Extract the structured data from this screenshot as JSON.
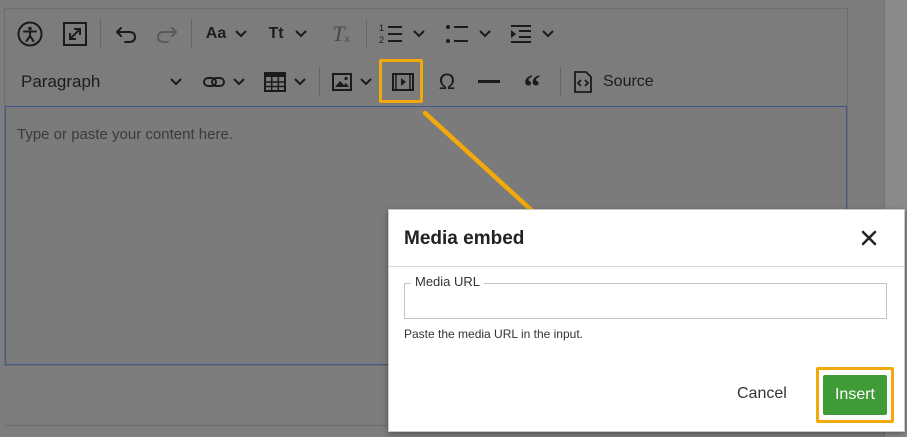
{
  "toolbar": {
    "paragraph_label": "Paragraph",
    "source_label": "Source"
  },
  "editor": {
    "placeholder": "Type or paste your content here."
  },
  "dialog": {
    "title": "Media embed",
    "field_label": "Media URL",
    "field_value": "",
    "help_text": "Paste the media URL in the input.",
    "cancel_label": "Cancel",
    "insert_label": "Insert"
  },
  "colors": {
    "highlight": "#f2a90c",
    "insert_button": "#3f9b35",
    "overlay": "#7d7d7d"
  }
}
